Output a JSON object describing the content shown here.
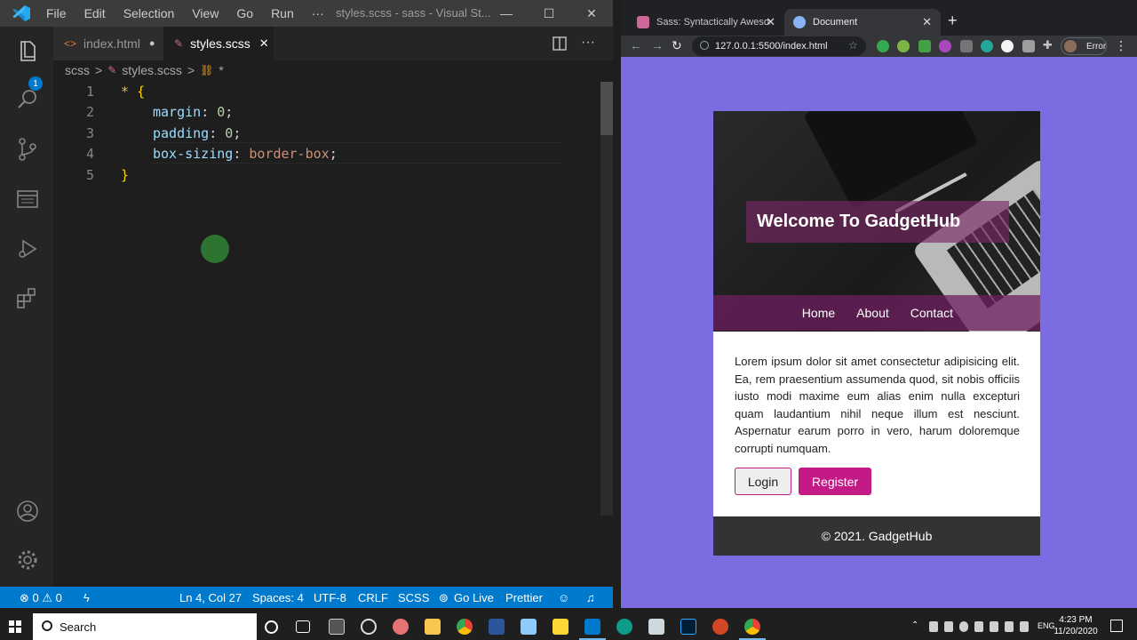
{
  "vscode": {
    "menu": [
      "File",
      "Edit",
      "Selection",
      "View",
      "Go",
      "Run",
      "···"
    ],
    "title": "styles.scss - sass - Visual St...",
    "activity_badge": "1",
    "tabs": [
      {
        "label": "index.html",
        "modified_dot": "●"
      },
      {
        "label": "styles.scss",
        "close": "✕"
      }
    ],
    "breadcrumb": [
      "scss",
      ">",
      "styles.scss",
      ">",
      "*"
    ],
    "editor": {
      "line_numbers": [
        "1",
        "2",
        "3",
        "4",
        "5"
      ],
      "lines": {
        "l1_sel": "*",
        "l1_brace": "{",
        "l2_prop": "margin",
        "l2_colon": ": ",
        "l2_val": "0",
        "l2_semi": ";",
        "l3_prop": "padding",
        "l3_colon": ": ",
        "l3_val": "0",
        "l3_semi": ";",
        "l4_prop": "box-sizing",
        "l4_colon": ": ",
        "l4_val": "border-box",
        "l4_semi": ";",
        "l5_brace": "}"
      }
    },
    "status": {
      "errors": "⊗ 0 ⚠ 0",
      "position": "Ln 4, Col 27",
      "spaces": "Spaces: 4",
      "encoding": "UTF-8",
      "eol": "CRLF",
      "language": "SCSS",
      "golive": "Go Live",
      "prettier": "Prettier"
    }
  },
  "browser": {
    "tabs": [
      {
        "label": "Sass: Syntactically Awesome Style"
      },
      {
        "label": "Document"
      }
    ],
    "new_tab": "+",
    "url": "127.0.0.1:5500/index.html",
    "profile_label": "Error",
    "page": {
      "hero_title": "Welcome To GadgetHub",
      "nav": [
        "Home",
        "About",
        "Contact"
      ],
      "body_text": "Lorem ipsum dolor sit amet consectetur adipisicing elit. Ea, rem praesentium assumenda quod, sit nobis officiis iusto modi maxime eum alias enim nulla excepturi quam laudantium nihil neque illum est nesciunt. Aspernatur earum porro in vero, harum doloremque corrupti numquam.",
      "login_label": "Login",
      "register_label": "Register",
      "footer": "© 2021. GadgetHub"
    },
    "colors": {
      "page_bg": "#7b6de1",
      "accent": "#c41a86",
      "footer_bg": "#333333"
    }
  },
  "taskbar": {
    "search_placeholder": "Search",
    "lang": "ENG",
    "time": "4:23 PM",
    "date": "11/20/2020"
  }
}
